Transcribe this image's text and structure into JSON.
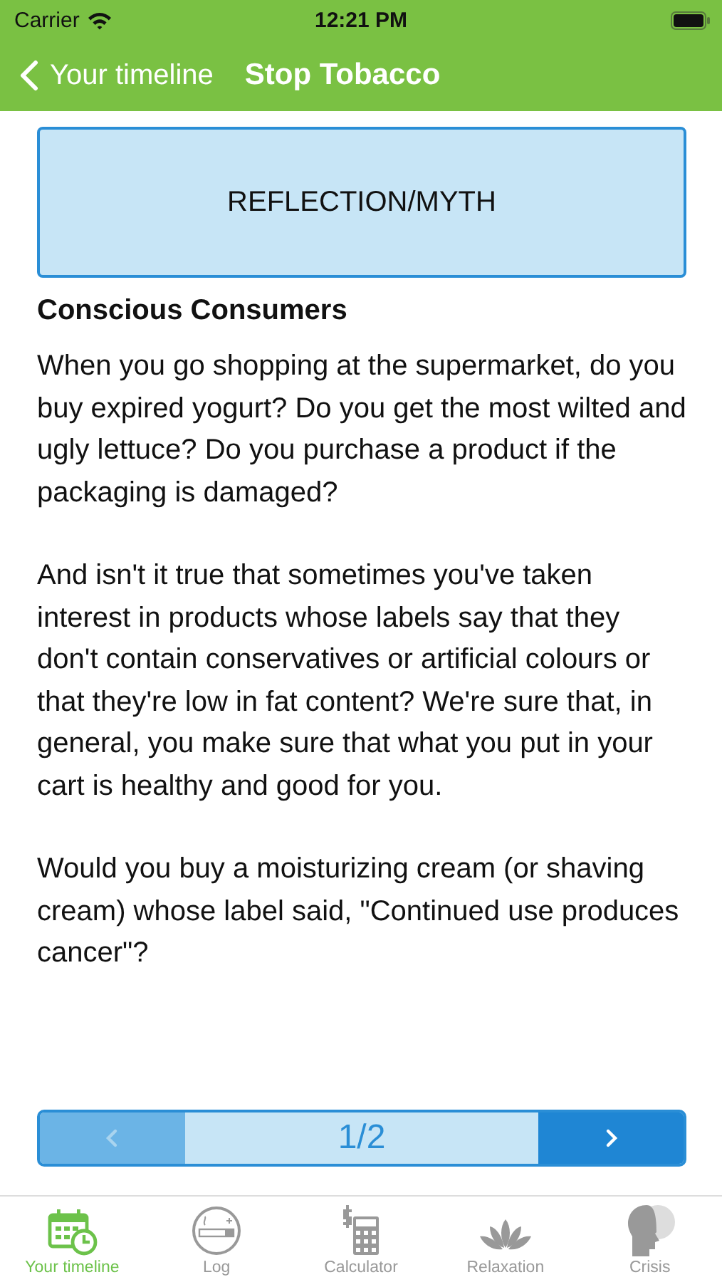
{
  "status_bar": {
    "carrier": "Carrier",
    "time": "12:21 PM"
  },
  "nav": {
    "back": "Your timeline",
    "title": "Stop Tobacco"
  },
  "banner": "REFLECTION/MYTH",
  "heading": "Conscious Consumers",
  "paragraphs": [
    "When you go shopping at the supermarket, do you buy expired yogurt? Do you get the most wilted and ugly lettuce? Do you purchase a product if the packaging is damaged?",
    "And isn't it true that sometimes you've taken interest in products whose labels say that they don't contain conservatives or artificial colours or that they're low in fat content? We're sure that, in general, you make sure that what you put in your cart is healthy and good for you.",
    "Would you buy a moisturizing cream (or shaving cream) whose label said, \"Continued use produces cancer\"?"
  ],
  "pager": {
    "prev_disabled": true,
    "next_disabled": false,
    "page": "1/2"
  },
  "tabs": [
    {
      "kind": "calendar",
      "label": "Your timeline",
      "selected": true
    },
    {
      "kind": "cigarette",
      "label": "Log",
      "selected": false
    },
    {
      "kind": "calculator",
      "label": "Calculator",
      "selected": false
    },
    {
      "kind": "lotus",
      "label": "Relaxation",
      "selected": false
    },
    {
      "kind": "head",
      "label": "Crisis",
      "selected": false
    }
  ]
}
